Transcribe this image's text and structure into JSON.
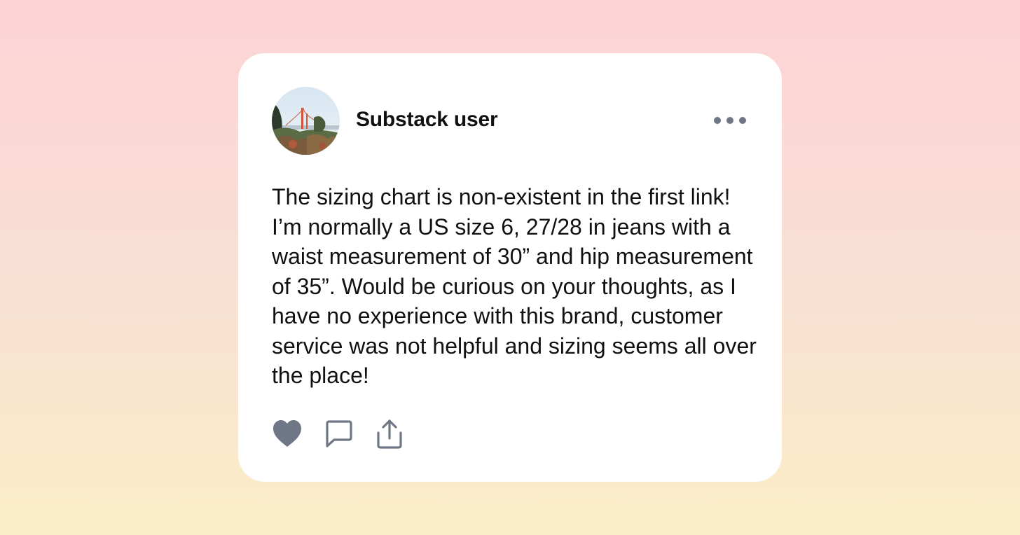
{
  "colors": {
    "background_top": "#fdd4d6",
    "background_bottom": "#fbecc8",
    "card": "#ffffff",
    "text": "#111111",
    "icon": "#6f7786"
  },
  "post": {
    "author": "Substack user",
    "avatar_icon": "avatar-photo-bridge",
    "body": "The sizing chart is non-existent in the first link! I’m normally a US size 6, 27/28 in jeans with a waist measurement of 30” and hip measurement of 35”. Would be curious on your thoughts, as I have no experience with this brand, customer service was not helpful and sizing seems all over the place!",
    "menu_icon": "more-horizontal-icon"
  },
  "actions": [
    {
      "name": "like",
      "icon": "heart-icon"
    },
    {
      "name": "comment",
      "icon": "speech-bubble-icon"
    },
    {
      "name": "share",
      "icon": "share-icon"
    }
  ]
}
